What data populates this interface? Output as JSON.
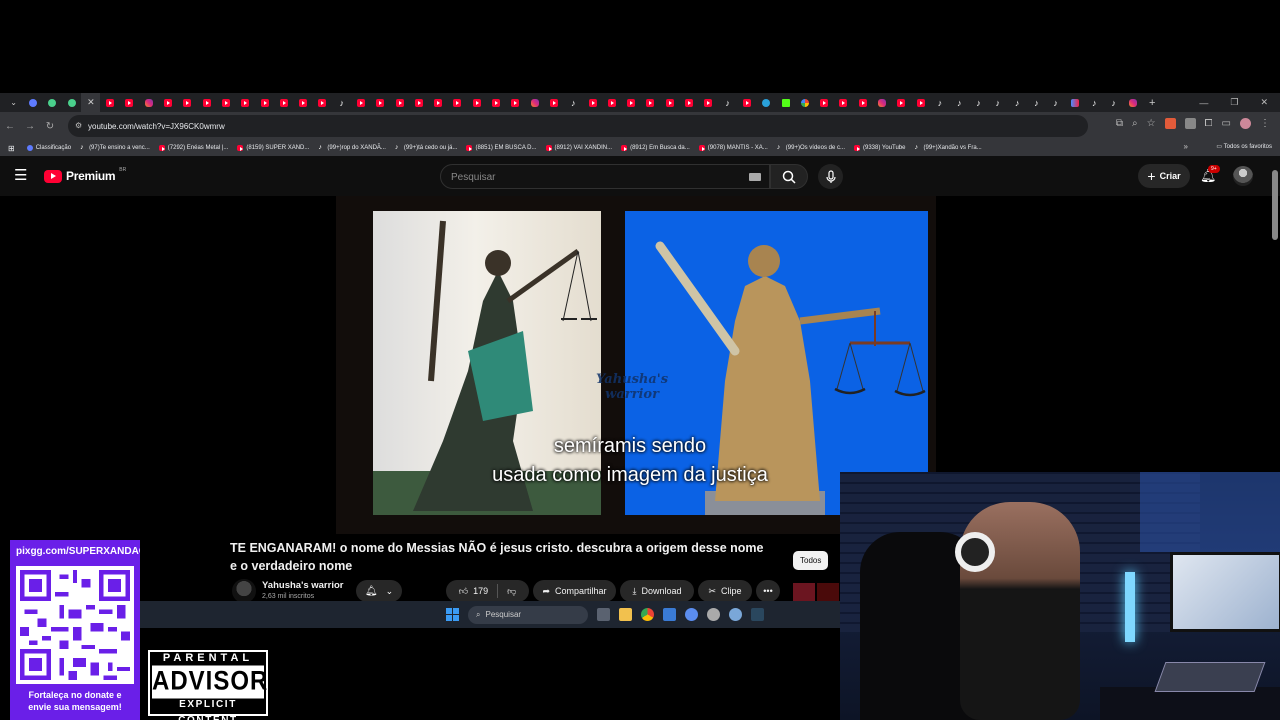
{
  "browser": {
    "url": "youtube.com/watch?v=JX96CK0wmrw",
    "tabs": [
      "tabs-dropdown",
      "google",
      "ext",
      "ext",
      "active-close",
      "yt",
      "yt",
      "ig",
      "yt",
      "yt",
      "yt",
      "yt",
      "yt",
      "yt",
      "yt",
      "yt",
      "yt",
      "tt",
      "yt",
      "yt",
      "yt",
      "yt",
      "yt",
      "yt",
      "yt",
      "yt",
      "yt",
      "ig",
      "yt",
      "tt",
      "yt",
      "yt",
      "yt",
      "yt",
      "yt",
      "yt",
      "yt",
      "tt",
      "yt",
      "tg",
      "kk",
      "go",
      "yt",
      "yt",
      "yt",
      "ig",
      "yt",
      "yt",
      "tt",
      "tt",
      "tt",
      "tt",
      "tt",
      "tt",
      "tt",
      "ms",
      "tt",
      "tt",
      "ig",
      "new"
    ],
    "bookmarks": [
      {
        "icon": "google",
        "label": "Classificação"
      },
      {
        "icon": "tt",
        "label": "(97)Te ensino a venc..."
      },
      {
        "icon": "yt",
        "label": "(7292) Enéas Metal |..."
      },
      {
        "icon": "yt",
        "label": "(8159) SUPER XAND..."
      },
      {
        "icon": "tt",
        "label": "(99+)rop do XANDÃ..."
      },
      {
        "icon": "tt",
        "label": "(99+)tá cedo ou já..."
      },
      {
        "icon": "yt",
        "label": "(8851) EM BUSCA D..."
      },
      {
        "icon": "yt",
        "label": "(8912) VAI XANDIN..."
      },
      {
        "icon": "yt",
        "label": "(8912) Em Busca da..."
      },
      {
        "icon": "yt",
        "label": "(9078) MANTIS - XA..."
      },
      {
        "icon": "tt",
        "label": "(99+)Os vídeos de c..."
      },
      {
        "icon": "yt",
        "label": "(9338) YouTube"
      },
      {
        "icon": "tt",
        "label": "(99+)Xandão vs Fra..."
      }
    ],
    "all_favorites": "Todos os favoritos"
  },
  "youtube": {
    "logo_text": "Premium",
    "region": "BR",
    "search_placeholder": "Pesquisar",
    "create_label": "Criar",
    "notif_badge": "9+",
    "video": {
      "caption_line1": "semíramis sendo",
      "caption_line2": "usada como imagem da justiça",
      "watermark_line1": "Yahusha's",
      "watermark_line2": "warrior"
    },
    "title": "TE ENGANARAM! o nome do Messias NÃO é jesus cristo. descubra a origem desse nome e o verdadeiro nome",
    "channel_name": "Yahusha's warrior",
    "subscribers": "2,63 mil inscritos",
    "likes": "179",
    "share_label": "Compartilhar",
    "download_label": "Download",
    "clip_label": "Clipe",
    "filter_chip": "Todos"
  },
  "taskbar": {
    "search_placeholder": "Pesquisar"
  },
  "overlay": {
    "qr_url": "pixgg.com/SUPERXANDAO",
    "qr_message_line1": "Fortaleça no donate e",
    "qr_message_line2": "envie sua mensagem!",
    "advisory_top": "PARENTAL",
    "advisory_mid": "ADVISORY",
    "advisory_bottom": "EXPLICIT CONTENT"
  },
  "colors": {
    "yt_red": "#ff0033",
    "qr_panel": "#6a1fe8",
    "video_blue": "#0b62e5"
  }
}
